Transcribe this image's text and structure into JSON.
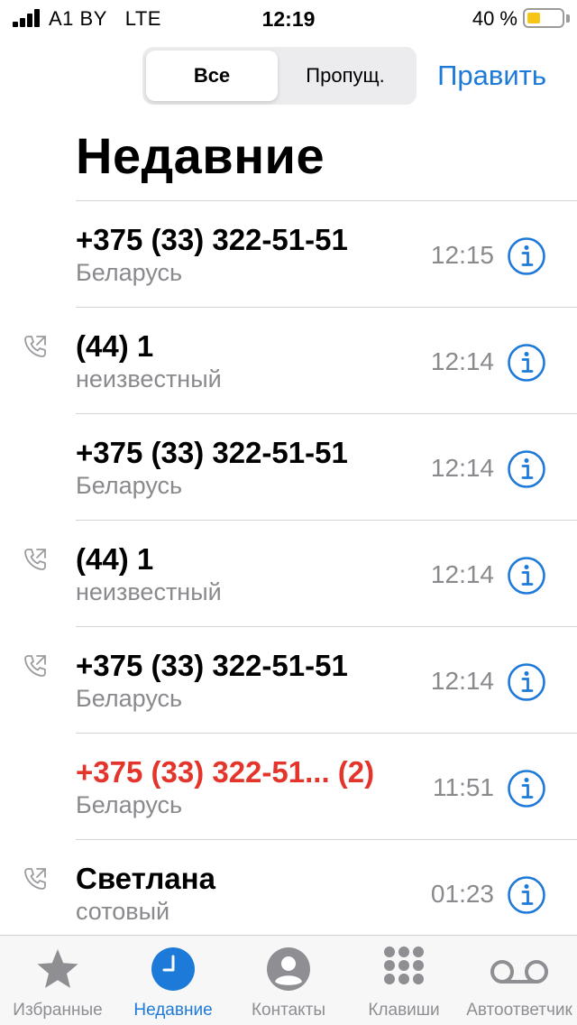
{
  "status_bar": {
    "carrier": "A1 BY",
    "network": "LTE",
    "time": "12:19",
    "battery_percent": "40 %",
    "battery_level": 0.4,
    "battery_color": "#f5c518"
  },
  "header": {
    "segments": [
      {
        "label": "Все",
        "selected": true
      },
      {
        "label": "Пропущ.",
        "selected": false
      }
    ],
    "edit_label": "Править",
    "title": "Недавние"
  },
  "colors": {
    "accent": "#1e7ad8",
    "missed": "#e3352b",
    "secondary_text": "#8a8a8e"
  },
  "calls": [
    {
      "name": "+375 (33) 322-51-51",
      "detail": "Беларусь",
      "time": "12:15",
      "outgoing": false,
      "missed": false
    },
    {
      "name": "(44) 1",
      "detail": "неизвестный",
      "time": "12:14",
      "outgoing": true,
      "missed": false
    },
    {
      "name": "+375 (33) 322-51-51",
      "detail": "Беларусь",
      "time": "12:14",
      "outgoing": false,
      "missed": false
    },
    {
      "name": "(44) 1",
      "detail": "неизвестный",
      "time": "12:14",
      "outgoing": true,
      "missed": false
    },
    {
      "name": "+375 (33) 322-51-51",
      "detail": "Беларусь",
      "time": "12:14",
      "outgoing": true,
      "missed": false
    },
    {
      "name": "+375 (33) 322-51...  (2)",
      "detail": "Беларусь",
      "time": "11:51",
      "outgoing": false,
      "missed": true
    },
    {
      "name": "Светлана",
      "detail": "сотовый",
      "time": "01:23",
      "outgoing": true,
      "missed": false
    }
  ],
  "tabs": [
    {
      "label": "Избранные",
      "icon": "star-icon",
      "active": false
    },
    {
      "label": "Недавние",
      "icon": "clock-icon",
      "active": true
    },
    {
      "label": "Контакты",
      "icon": "person-icon",
      "active": false
    },
    {
      "label": "Клавиши",
      "icon": "keypad-icon",
      "active": false
    },
    {
      "label": "Автоответчик",
      "icon": "voicemail-icon",
      "active": false
    }
  ]
}
